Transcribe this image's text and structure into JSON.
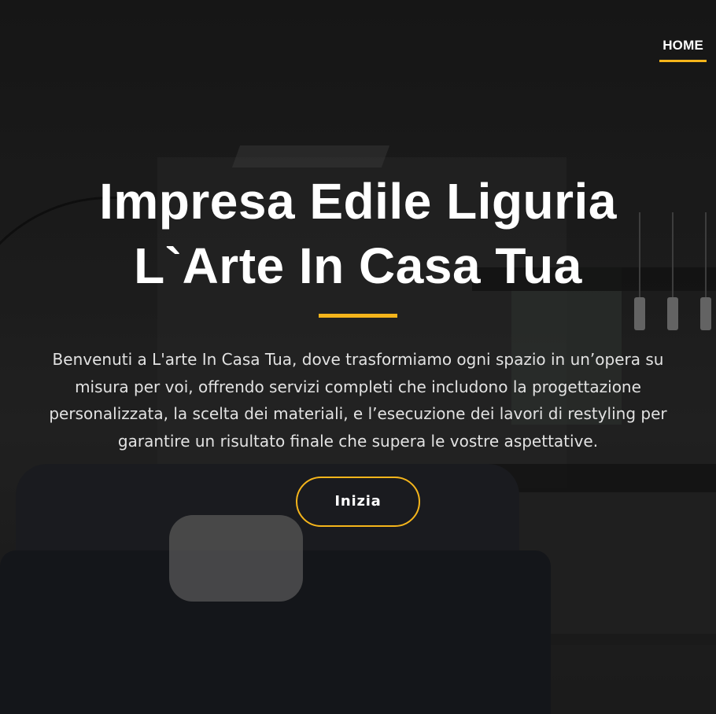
{
  "nav": {
    "items": [
      {
        "label": "HOME",
        "active": true
      }
    ]
  },
  "hero": {
    "title_line1": "Impresa Edile Liguria",
    "title_line2": "L`Arte In Casa Tua",
    "description": "Benvenuti a L'arte In Casa Tua, dove trasformiamo ogni spazio in un’opera su misura per voi, offrendo servizi completi che includono la progettazione personalizzata, la scelta dei materiali, e l’esecuzione dei lavori di restyling per garantire un risultato finale che supera le vostre aspettative.",
    "cta_label": "Inizia",
    "background": "dark living room interior photo"
  },
  "colors": {
    "accent": "#f5b51b",
    "text": "#ffffff",
    "overlay": "#000000"
  }
}
